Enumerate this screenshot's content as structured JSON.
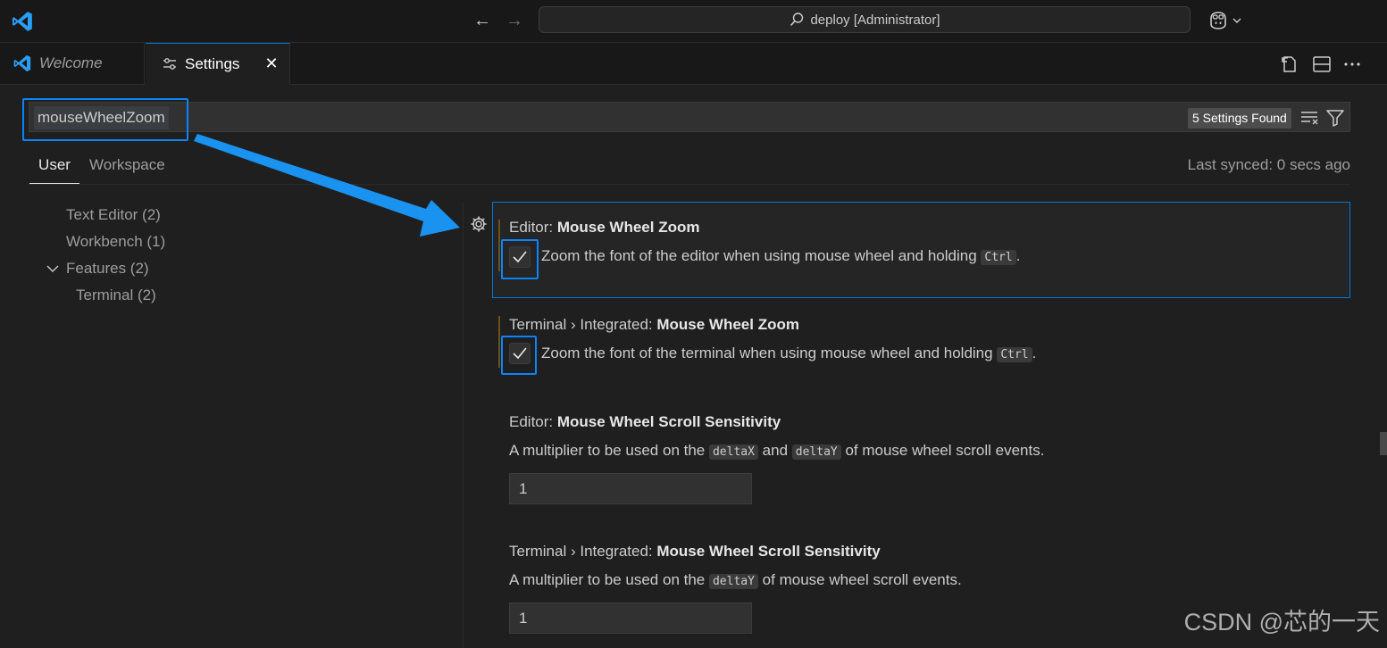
{
  "titlebar": {
    "command_center": "deploy [Administrator]",
    "icons": [
      "vscode-logo-icon",
      "arrow-left-icon",
      "arrow-right-icon",
      "search-icon",
      "copilot-icon",
      "chevron-down-icon"
    ]
  },
  "tabs": [
    {
      "label": "Welcome",
      "icon": "vscode-logo-icon",
      "active": false
    },
    {
      "label": "Settings",
      "icon": "settings-sliders-icon",
      "active": true
    }
  ],
  "editor_actions": [
    "open-settings-json-icon",
    "split-editor-icon",
    "more-actions-icon"
  ],
  "search": {
    "query": "mouseWheelZoom",
    "results_badge": "5 Settings Found"
  },
  "scope": {
    "user": "User",
    "workspace": "Workspace",
    "last_synced": "Last synced: 0 secs ago"
  },
  "toc": {
    "text_editor": "Text Editor (2)",
    "workbench": "Workbench (1)",
    "features": "Features (2)",
    "terminal": "Terminal (2)"
  },
  "settings": [
    {
      "category": "Editor: ",
      "name": "Mouse Wheel Zoom",
      "desc_before": "Zoom the font of the editor when using mouse wheel and holding ",
      "code": "Ctrl",
      "desc_after": ".",
      "checked": true
    },
    {
      "category": "Terminal › Integrated: ",
      "name": "Mouse Wheel Zoom",
      "desc_before": "Zoom the font of the terminal when using mouse wheel and holding ",
      "code": "Ctrl",
      "desc_after": ".",
      "checked": true
    },
    {
      "category": "Editor: ",
      "name": "Mouse Wheel Scroll Sensitivity",
      "desc_before": "A multiplier to be used on the ",
      "code1": "deltaX",
      "desc_mid": " and ",
      "code2": "deltaY",
      "desc_after": " of mouse wheel scroll events.",
      "value": "1"
    },
    {
      "category": "Terminal › Integrated: ",
      "name": "Mouse Wheel Scroll Sensitivity",
      "desc_before": "A multiplier to be used on the ",
      "code": "deltaY",
      "desc_after": " of mouse wheel scroll events.",
      "value": "1"
    }
  ],
  "watermark": "CSDN @芯的一天",
  "colors": {
    "accent": "#0078d4",
    "annotation": "#0a84ff",
    "background": "#1f1f1f"
  }
}
